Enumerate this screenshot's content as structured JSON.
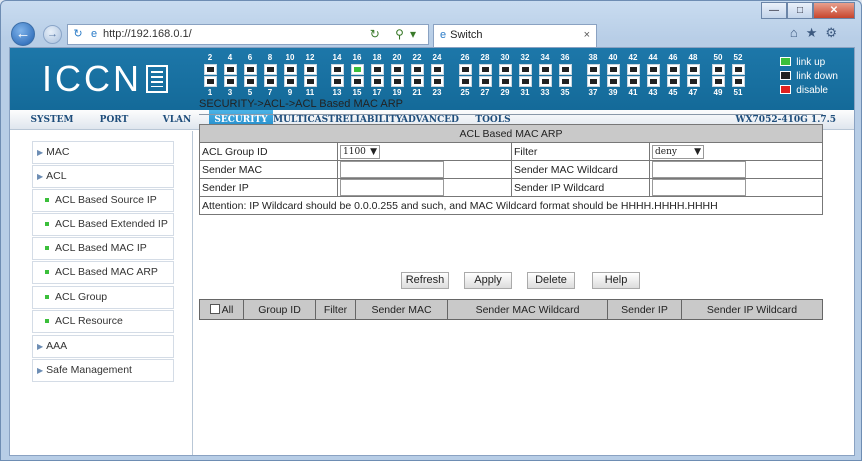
{
  "browser": {
    "url": "http://192.168.0.1/",
    "tab_title": "Switch",
    "tab_close": "×"
  },
  "banner": {
    "logo_text": "ICCN",
    "legend": [
      {
        "label": "link up",
        "color": "#3bbf3b"
      },
      {
        "label": "link down",
        "color": "#222222"
      },
      {
        "label": "disable",
        "color": "#e02020"
      }
    ],
    "port_groups": [
      {
        "top": [
          "2",
          "4",
          "6",
          "8",
          "10",
          "12"
        ],
        "bottom": [
          "1",
          "3",
          "5",
          "7",
          "9",
          "11"
        ]
      },
      {
        "top": [
          "14",
          "16",
          "18",
          "20",
          "22",
          "24"
        ],
        "bottom": [
          "13",
          "15",
          "17",
          "19",
          "21",
          "23"
        ],
        "up_top": [
          1
        ]
      },
      {
        "top": [
          "26",
          "28",
          "30",
          "32",
          "34",
          "36"
        ],
        "bottom": [
          "25",
          "27",
          "29",
          "31",
          "33",
          "35"
        ]
      },
      {
        "top": [
          "38",
          "40",
          "42",
          "44",
          "46",
          "48"
        ],
        "bottom": [
          "37",
          "39",
          "41",
          "43",
          "45",
          "47"
        ]
      },
      {
        "top": [
          "50",
          "52"
        ],
        "bottom": [
          "49",
          "51"
        ]
      }
    ]
  },
  "menu": {
    "items": [
      "SYSTEM",
      "PORT",
      "VLAN",
      "SECURITY",
      "MULTICAST",
      "RELIABILITY",
      "ADVANCED",
      "TOOLS"
    ],
    "active": "SECURITY",
    "version": "WX7052-410G 1.7.5"
  },
  "sidebar": {
    "items": [
      {
        "label": "MAC",
        "type": "group"
      },
      {
        "label": "ACL",
        "type": "group"
      },
      {
        "label": "ACL Based Source IP",
        "type": "sub"
      },
      {
        "label": "ACL Based Extended IP",
        "type": "sub"
      },
      {
        "label": "ACL Based MAC IP",
        "type": "sub"
      },
      {
        "label": "ACL Based MAC ARP",
        "type": "sub"
      },
      {
        "label": "ACL Group",
        "type": "sub"
      },
      {
        "label": "ACL Resource",
        "type": "sub"
      },
      {
        "label": "AAA",
        "type": "group"
      },
      {
        "label": "Safe Management",
        "type": "group"
      }
    ]
  },
  "main": {
    "breadcrumb": "SECURITY->ACL->ACL Based MAC ARP",
    "form": {
      "title": "ACL Based MAC ARP",
      "acl_group_id_label": "ACL Group ID",
      "acl_group_id_value": "1100",
      "filter_label": "Filter",
      "filter_value": "deny",
      "sender_mac_label": "Sender MAC",
      "sender_mac_value": "",
      "sender_mac_wildcard_label": "Sender MAC Wildcard",
      "sender_mac_wildcard_value": "",
      "sender_ip_label": "Sender IP",
      "sender_ip_value": "",
      "sender_ip_wildcard_label": "Sender IP Wildcard",
      "sender_ip_wildcard_value": "",
      "attention": "Attention: IP Wildcard should be 0.0.0.255 and such, and MAC Wildcard format should be HHHH.HHHH.HHHH"
    },
    "buttons": {
      "refresh": "Refresh",
      "apply": "Apply",
      "delete": "Delete",
      "help": "Help"
    },
    "list": {
      "all_label": "All",
      "columns": [
        "Group ID",
        "Filter",
        "Sender MAC",
        "Sender MAC Wildcard",
        "Sender IP",
        "Sender IP Wildcard"
      ]
    }
  }
}
